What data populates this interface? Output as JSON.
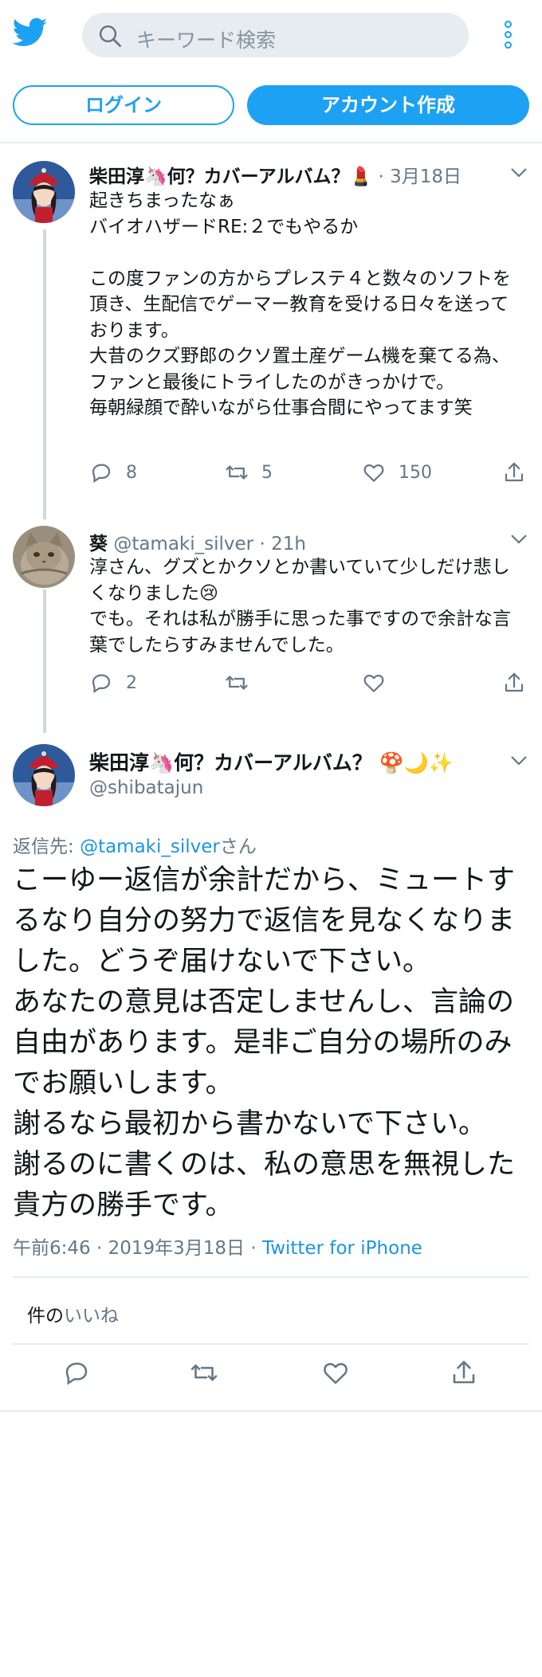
{
  "header": {
    "search_placeholder": "キーワード検索",
    "login_label": "ログイン",
    "signup_label": "アカウント作成"
  },
  "tweets": [
    {
      "name": "柴田淳🦄何？カバーアルバム？💄",
      "date": "3月18日",
      "text": "起きちまったなぁ\nバイオハザードRE:２でもやるか\n\nこの度ファンの方からプレステ４と数々のソフトを頂き、生配信でゲーマー教育を受ける日々を送っております。\n大昔のクズ野郎のクソ置土産ゲーム機を棄てる為、ファンと最後にトライしたのがきっかけで。\n毎朝緑顔で酔いながら仕事合間にやってます笑",
      "replies": "8",
      "retweets": "5",
      "likes": "150"
    },
    {
      "name": "葵",
      "handle": "@tamaki_silver",
      "date": "21h",
      "text": "淳さん、グズとかクソとか書いていて少しだけ悲しくなりました😢\nでも。それは私が勝手に思った事ですので余計な言葉でしたらすみませんでした。",
      "replies": "2"
    }
  ],
  "main_tweet": {
    "name": "柴田淳🦄何？カバーアルバム？ 🍄🌙✨",
    "handle": "@shibatajun",
    "reply_prefix": "返信先: ",
    "reply_handle": "@tamaki_silver",
    "reply_suffix": "さん",
    "text": "こーゆー返信が余計だから、ミュートするなり自分の努力で返信を見なくなりました。どうぞ届けないで下さい。\nあなたの意見は否定しませんし、言論の自由があります。是非ご自分の場所のみでお願いします。\n謝るなら最初から書かないで下さい。\n謝るのに書くのは、私の意思を無視した貴方の勝手です。",
    "time": "午前6:46 · 2019年3月18日 · ",
    "source": "Twitter for iPhone",
    "likes_prefix": "件の",
    "likes_label": "いいね"
  },
  "colors": {
    "accent": "#1da1f2",
    "link": "#1b95e0",
    "muted": "#657786",
    "border": "#e6ecf0"
  },
  "icons": [
    "twitter-bird-icon",
    "search-icon",
    "more-icon",
    "chevron-down-icon",
    "reply-icon",
    "retweet-icon",
    "like-icon",
    "share-icon"
  ]
}
